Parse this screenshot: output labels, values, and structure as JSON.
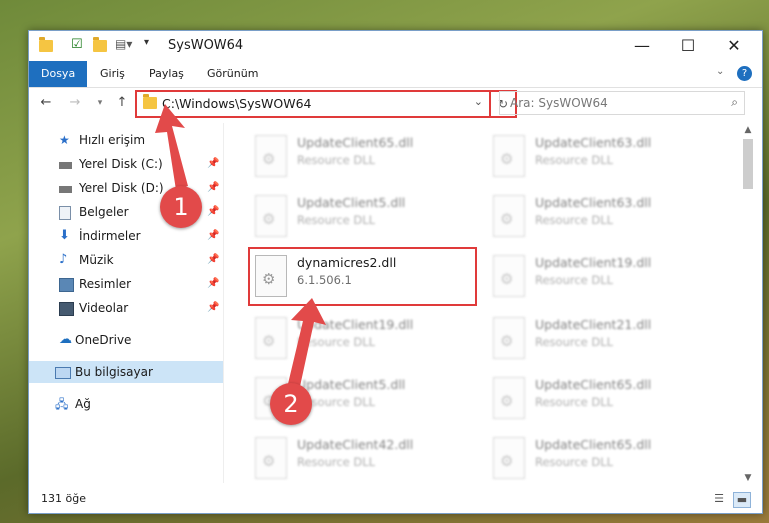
{
  "window": {
    "title": "SysWOW64"
  },
  "ribbon": {
    "tabs": [
      "Dosya",
      "Giriş",
      "Paylaş",
      "Görünüm"
    ]
  },
  "address": {
    "path": "C:\\Windows\\SysWOW64",
    "search_placeholder": "Ara: SysWOW64"
  },
  "sidebar": {
    "items": [
      {
        "label": "Hızlı erişim",
        "icon": "star-icon"
      },
      {
        "label": "Yerel Disk (C:)",
        "icon": "drive-icon",
        "pinned": true
      },
      {
        "label": "Yerel Disk (D:)",
        "icon": "drive-icon",
        "pinned": true
      },
      {
        "label": "Belgeler",
        "icon": "documents-icon",
        "pinned": true
      },
      {
        "label": "İndirmeler",
        "icon": "download-icon",
        "pinned": true
      },
      {
        "label": "Müzik",
        "icon": "music-icon",
        "pinned": true
      },
      {
        "label": "Resimler",
        "icon": "pictures-icon",
        "pinned": true
      },
      {
        "label": "Videolar",
        "icon": "videos-icon",
        "pinned": true
      },
      {
        "label": "OneDrive",
        "icon": "cloud-icon"
      },
      {
        "label": "Bu bilgisayar",
        "icon": "computer-icon",
        "selected": true
      },
      {
        "label": "Ağ",
        "icon": "network-icon"
      }
    ]
  },
  "files": [
    {
      "name": "UpdateClient65.dll",
      "desc": "Resource DLL"
    },
    {
      "name": "UpdateClient63.dll",
      "desc": "Resource DLL"
    },
    {
      "name": "UpdateClient5.dll",
      "desc": "Resource DLL"
    },
    {
      "name": "UpdateClient63.dll",
      "desc": "Resource DLL"
    },
    {
      "name": "dynamicres2.dll",
      "desc": "6.1.506.1"
    },
    {
      "name": "UpdateClient19.dll",
      "desc": "Resource DLL"
    },
    {
      "name": "UpdateClient19.dll",
      "desc": "Resource DLL"
    },
    {
      "name": "UpdateClient21.dll",
      "desc": "Resource DLL"
    },
    {
      "name": "UpdateClient5.dll",
      "desc": "Resource DLL"
    },
    {
      "name": "UpdateClient65.dll",
      "desc": "Resource DLL"
    },
    {
      "name": "UpdateClient42.dll",
      "desc": "Resource DLL"
    },
    {
      "name": "UpdateClient65.dll",
      "desc": "Resource DLL"
    }
  ],
  "status": {
    "count": "131 öğe"
  },
  "callouts": [
    "1",
    "2"
  ],
  "colors": {
    "accent": "#1e6fbf",
    "highlight": "#e03a3a",
    "callout": "#e24a4a"
  }
}
